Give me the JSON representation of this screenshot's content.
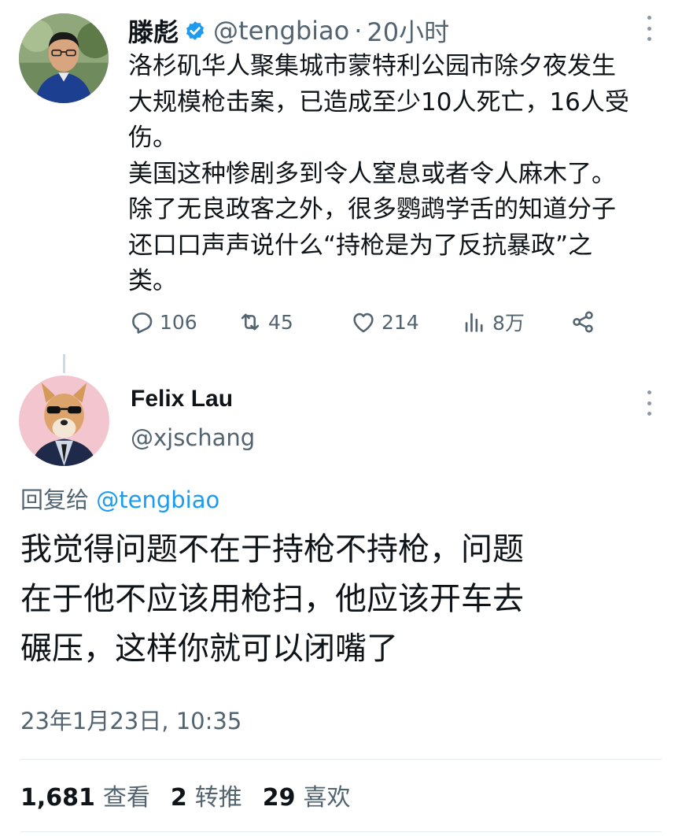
{
  "tweet1": {
    "author_name": "滕彪",
    "author_handle": "@tengbiao",
    "separator": "·",
    "time": "20小时",
    "text_lines": [
      "洛杉矶华人聚集城市蒙特利公园市除夕夜发生",
      "大规模枪击案，已造成至少10人死亡，16人受",
      "伤。",
      "美国这种惨剧多到令人窒息或者令人麻木了。",
      "除了无良政客之外，很多鹦鹉学舌的知道分子",
      "还口口声声说什么“持枪是为了反抗暴政”之",
      "类。"
    ],
    "actions": {
      "replies": "106",
      "retweets": "45",
      "likes": "214",
      "views": "8万"
    },
    "colors": {
      "verified": "#1d9bf0",
      "muted": "#536471"
    }
  },
  "tweet2": {
    "author_name": "Felix Lau",
    "author_handle": "@xjschang",
    "reply_prefix": "回复给",
    "reply_mention": "@tengbiao",
    "text_lines": [
      "我觉得问题不在于持枪不持枪，问题",
      "在于他不应该用枪扫，他应该开车去",
      "碾压，这样你就可以闭嘴了"
    ],
    "timestamp": "23年1月23日, 10:35",
    "stats": {
      "views_count": "1,681",
      "views_label": "查看",
      "retweets_count": "2",
      "retweets_label": "转推",
      "likes_count": "29",
      "likes_label": "喜欢"
    },
    "colors": {
      "mention": "#1d9bf0"
    }
  },
  "icons": [
    "verified-badge-icon",
    "more-options-icon",
    "reply-icon",
    "retweet-icon",
    "like-icon",
    "views-icon",
    "share-icon"
  ]
}
